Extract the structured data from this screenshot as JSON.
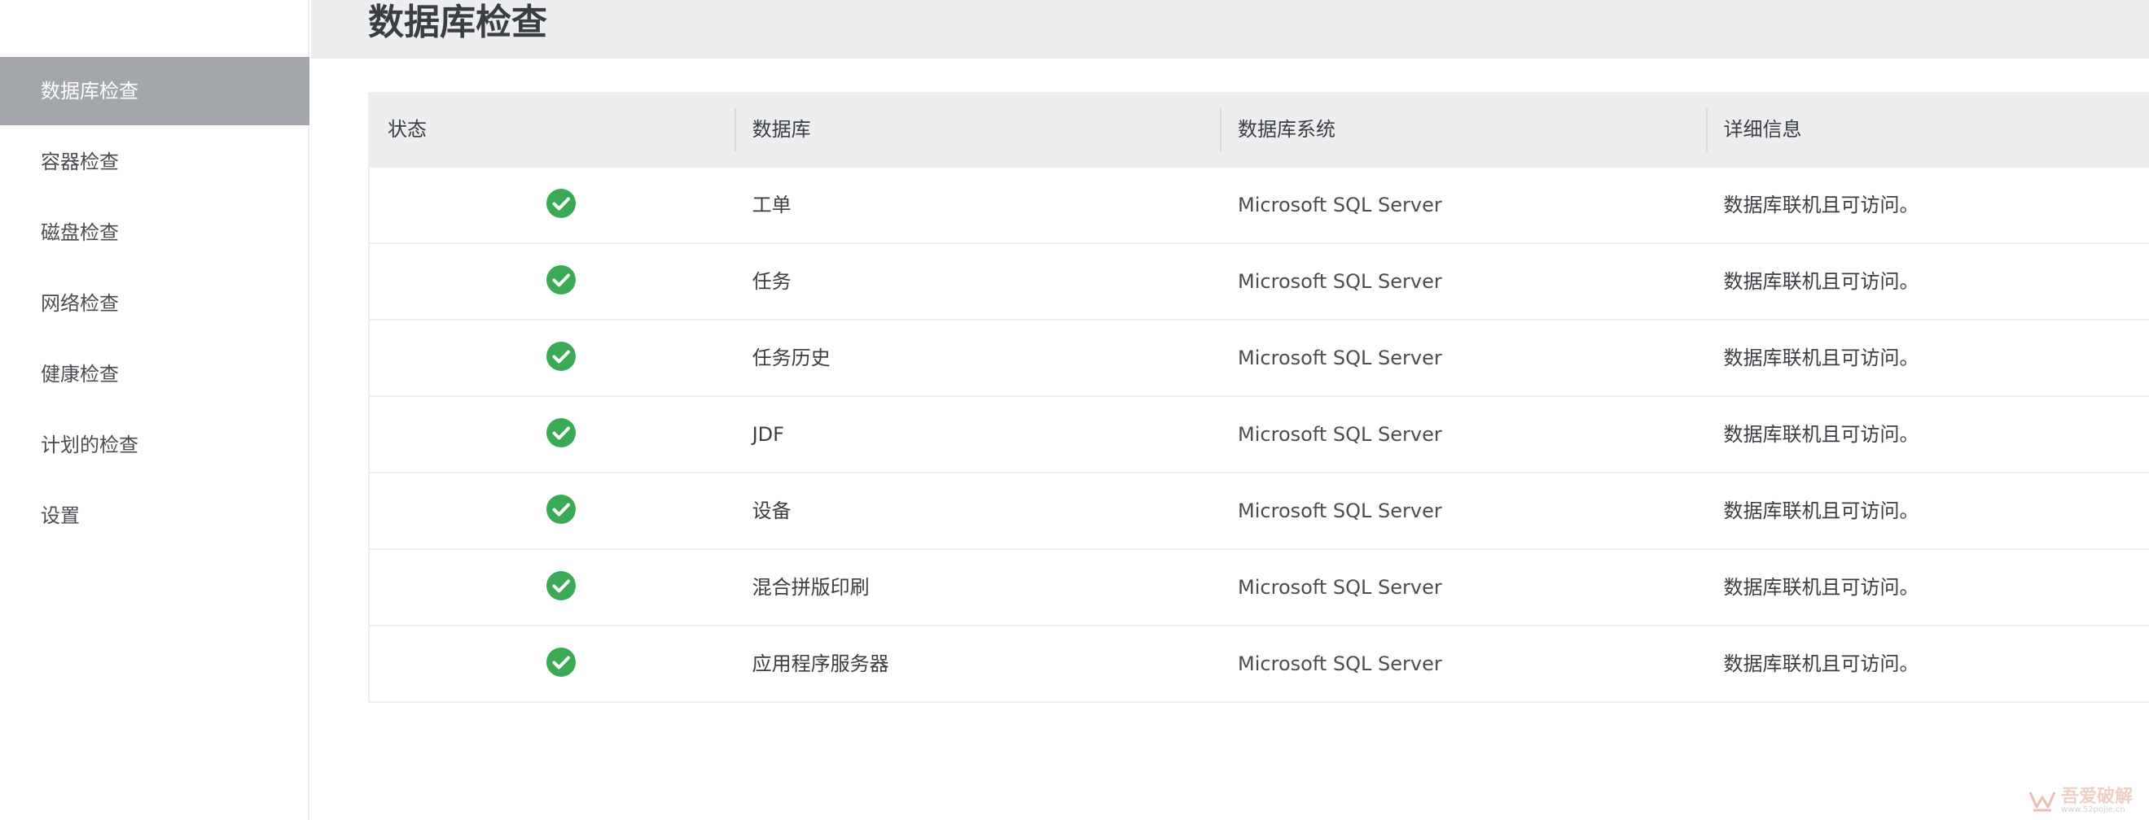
{
  "header": {
    "title": "数据库检查"
  },
  "sidebar": {
    "items": [
      {
        "label": "数据库检查",
        "active": true
      },
      {
        "label": "容器检查",
        "active": false
      },
      {
        "label": "磁盘检查",
        "active": false
      },
      {
        "label": "网络检查",
        "active": false
      },
      {
        "label": "健康检查",
        "active": false
      },
      {
        "label": "计划的检查",
        "active": false
      },
      {
        "label": "设置",
        "active": false
      }
    ]
  },
  "table": {
    "columns": [
      "状态",
      "数据库",
      "数据库系统",
      "详细信息"
    ],
    "rows": [
      {
        "status": "ok",
        "database": "工单",
        "system": "Microsoft SQL Server",
        "detail": "数据库联机且可访问。"
      },
      {
        "status": "ok",
        "database": "任务",
        "system": "Microsoft SQL Server",
        "detail": "数据库联机且可访问。"
      },
      {
        "status": "ok",
        "database": "任务历史",
        "system": "Microsoft SQL Server",
        "detail": "数据库联机且可访问。"
      },
      {
        "status": "ok",
        "database": "JDF",
        "system": "Microsoft SQL Server",
        "detail": "数据库联机且可访问。"
      },
      {
        "status": "ok",
        "database": "设备",
        "system": "Microsoft SQL Server",
        "detail": "数据库联机且可访问。"
      },
      {
        "status": "ok",
        "database": "混合拼版印刷",
        "system": "Microsoft SQL Server",
        "detail": "数据库联机且可访问。"
      },
      {
        "status": "ok",
        "database": "应用程序服务器",
        "system": "Microsoft SQL Server",
        "detail": "数据库联机且可访问。"
      }
    ]
  },
  "colors": {
    "success": "#3aaa57",
    "active_sidebar": "#a3a7ab",
    "header_bg": "#eceeef"
  },
  "icons": {
    "status_ok": "check-circle-icon"
  },
  "watermark": {
    "text": "吾爱破解",
    "url": "www.52pojie.cn"
  }
}
